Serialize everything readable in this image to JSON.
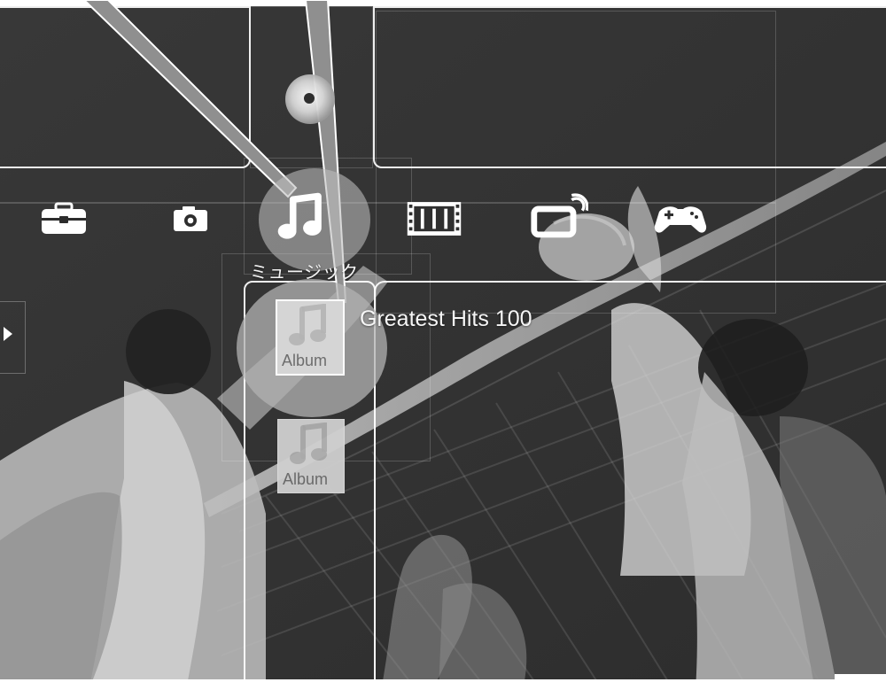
{
  "menu": {
    "items": [
      {
        "id": "settings",
        "icon": "toolbox-icon"
      },
      {
        "id": "photo",
        "icon": "camera-icon"
      },
      {
        "id": "music",
        "icon": "music-note-icon",
        "label": "ミュージック",
        "selected": true
      },
      {
        "id": "video",
        "icon": "film-strip-icon"
      },
      {
        "id": "tv",
        "icon": "tv-broadcast-icon"
      },
      {
        "id": "game",
        "icon": "gamepad-icon"
      }
    ]
  },
  "top_item": {
    "icon": "disc-icon"
  },
  "music_column": {
    "albums": [
      {
        "cover_text": "Album",
        "title": "Greatest Hits 100",
        "selected": true
      },
      {
        "cover_text": "Album",
        "selected": false
      }
    ]
  },
  "colors": {
    "background": "#3b3b3b",
    "highlight": "#bdbdbd",
    "text": "#f6f6f6",
    "frame": "#ffffff"
  }
}
